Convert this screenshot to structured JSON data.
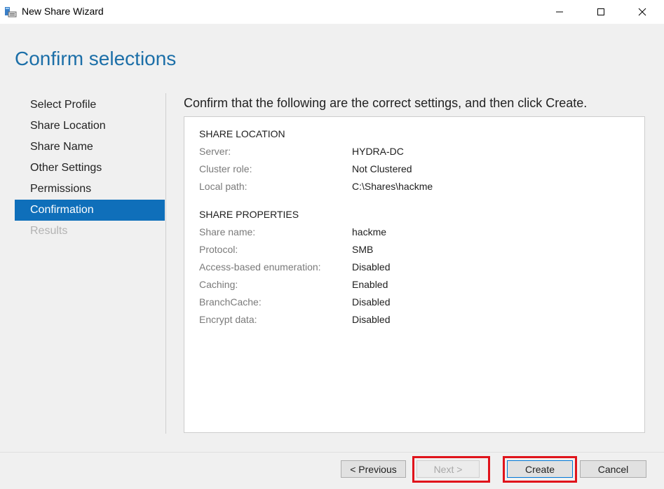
{
  "window": {
    "title": "New Share Wizard"
  },
  "page": {
    "title": "Confirm selections",
    "instruction": "Confirm that the following are the correct settings, and then click Create."
  },
  "nav": {
    "items": [
      {
        "label": "Select Profile",
        "state": "normal"
      },
      {
        "label": "Share Location",
        "state": "normal"
      },
      {
        "label": "Share Name",
        "state": "normal"
      },
      {
        "label": "Other Settings",
        "state": "normal"
      },
      {
        "label": "Permissions",
        "state": "normal"
      },
      {
        "label": "Confirmation",
        "state": "active"
      },
      {
        "label": "Results",
        "state": "disabled"
      }
    ]
  },
  "summary": {
    "share_location": {
      "heading": "SHARE LOCATION",
      "rows": [
        {
          "key": "Server:",
          "value": "HYDRA-DC"
        },
        {
          "key": "Cluster role:",
          "value": "Not Clustered"
        },
        {
          "key": "Local path:",
          "value": "C:\\Shares\\hackme"
        }
      ]
    },
    "share_properties": {
      "heading": "SHARE PROPERTIES",
      "rows": [
        {
          "key": "Share name:",
          "value": "hackme"
        },
        {
          "key": "Protocol:",
          "value": "SMB"
        },
        {
          "key": "Access-based enumeration:",
          "value": "Disabled"
        },
        {
          "key": "Caching:",
          "value": "Enabled"
        },
        {
          "key": "BranchCache:",
          "value": "Disabled"
        },
        {
          "key": "Encrypt data:",
          "value": "Disabled"
        }
      ]
    }
  },
  "buttons": {
    "previous": "< Previous",
    "next": "Next >",
    "create": "Create",
    "cancel": "Cancel"
  },
  "colors": {
    "accent": "#0f6fba",
    "title": "#1c6fa8",
    "highlight": "#e0131b"
  },
  "icons": {
    "app": "share-wizard-icon",
    "minimize": "minimize-icon",
    "maximize": "maximize-icon",
    "close": "close-icon"
  }
}
